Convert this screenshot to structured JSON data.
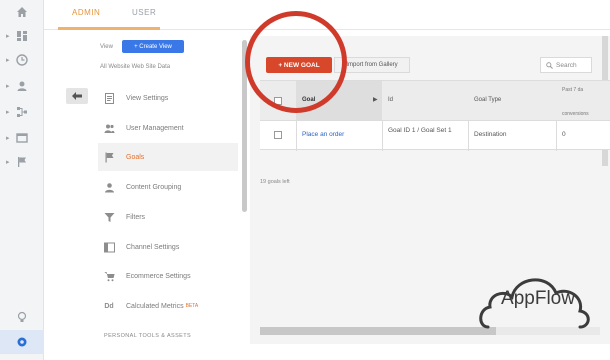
{
  "tabs": [
    {
      "label": "ADMIN",
      "active": true
    },
    {
      "label": "USER",
      "active": false
    }
  ],
  "rail": {
    "icons": [
      "home-icon",
      "dashboard-icon",
      "clock-icon",
      "person-icon",
      "flow-icon",
      "display-icon",
      "flag-icon",
      "lightbulb-icon",
      "gear-icon"
    ]
  },
  "view_column": {
    "label": "View",
    "create_view": "+ Create View",
    "view_name": "All Website Web Site Data",
    "items": [
      {
        "label": "View Settings",
        "icon": "document-icon",
        "active": false
      },
      {
        "label": "User Management",
        "icon": "people-icon",
        "active": false
      },
      {
        "label": "Goals",
        "icon": "flag-icon",
        "active": true
      },
      {
        "label": "Content Grouping",
        "icon": "person-icon",
        "active": false
      },
      {
        "label": "Filters",
        "icon": "filter-icon",
        "active": false
      },
      {
        "label": "Channel Settings",
        "icon": "channel-icon",
        "active": false
      },
      {
        "label": "Ecommerce Settings",
        "icon": "cart-icon",
        "active": false
      },
      {
        "label": "Calculated Metrics",
        "badge": "BETA",
        "icon": "dd-icon",
        "active": false
      }
    ],
    "section_title": "PERSONAL TOOLS & ASSETS"
  },
  "toolbar": {
    "new_goal": "+ NEW GOAL",
    "import": "Import from Gallery",
    "search_placeholder": "Search"
  },
  "table": {
    "headers": {
      "goal": "Goal",
      "id": "Id",
      "goal_type": "Goal Type",
      "past": "Past 7 da",
      "conversions": "conversions"
    },
    "rows": [
      {
        "goal": "Place an order",
        "id": "Goal ID 1 / Goal Set 1",
        "goal_type": "Destination",
        "conversions": "0"
      }
    ],
    "count": "19 goals left"
  },
  "watermark": "AppFlow",
  "colors": {
    "accent_orange": "#e8953a",
    "new_goal_red": "#d8472a",
    "ring_red": "#cf3a2b",
    "link_blue": "#2a64c5"
  }
}
